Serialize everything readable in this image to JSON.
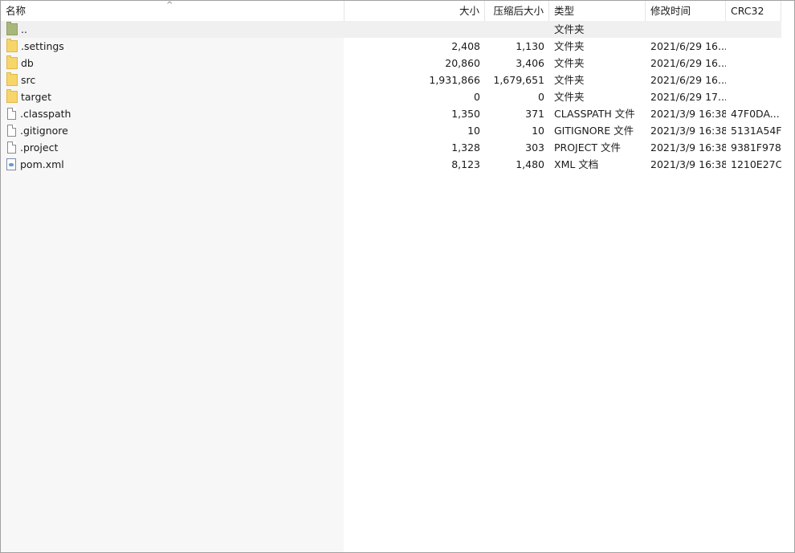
{
  "columns": {
    "name": "名称",
    "size": "大小",
    "packed": "压缩后大小",
    "type": "类型",
    "modified": "修改时间",
    "crc": "CRC32"
  },
  "sort_indicator": "^",
  "rows": [
    {
      "icon": "up-folder-icon",
      "name": "..",
      "size": "",
      "packed": "",
      "type": "文件夹",
      "modified": "",
      "crc": ""
    },
    {
      "icon": "folder-icon",
      "name": ".settings",
      "size": "2,408",
      "packed": "1,130",
      "type": "文件夹",
      "modified": "2021/6/29 16...",
      "crc": ""
    },
    {
      "icon": "folder-icon",
      "name": "db",
      "size": "20,860",
      "packed": "3,406",
      "type": "文件夹",
      "modified": "2021/6/29 16...",
      "crc": ""
    },
    {
      "icon": "folder-icon",
      "name": "src",
      "size": "1,931,866",
      "packed": "1,679,651",
      "type": "文件夹",
      "modified": "2021/6/29 16...",
      "crc": ""
    },
    {
      "icon": "folder-icon",
      "name": "target",
      "size": "0",
      "packed": "0",
      "type": "文件夹",
      "modified": "2021/6/29 17...",
      "crc": ""
    },
    {
      "icon": "file-icon",
      "name": ".classpath",
      "size": "1,350",
      "packed": "371",
      "type": "CLASSPATH 文件",
      "modified": "2021/3/9 16:38",
      "crc": "47F0DA..."
    },
    {
      "icon": "file-icon",
      "name": ".gitignore",
      "size": "10",
      "packed": "10",
      "type": "GITIGNORE 文件",
      "modified": "2021/3/9 16:38",
      "crc": "5131A54F"
    },
    {
      "icon": "file-icon",
      "name": ".project",
      "size": "1,328",
      "packed": "303",
      "type": "PROJECT 文件",
      "modified": "2021/3/9 16:38",
      "crc": "9381F978"
    },
    {
      "icon": "xml-file-icon",
      "name": "pom.xml",
      "size": "8,123",
      "packed": "1,480",
      "type": "XML 文档",
      "modified": "2021/3/9 16:38",
      "crc": "1210E27C"
    }
  ]
}
